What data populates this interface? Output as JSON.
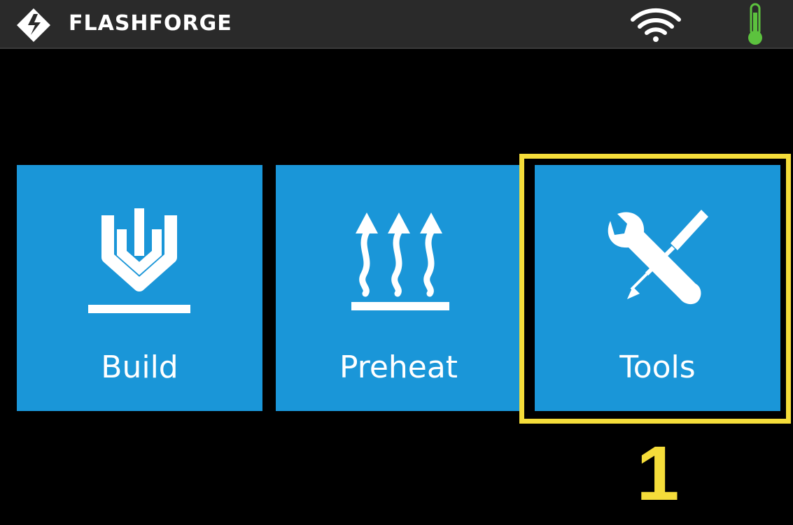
{
  "header": {
    "brand": "FLASHFORGE",
    "logo_icon": "flashforge-logo-icon",
    "wifi_icon": "wifi-icon",
    "temperature_icon": "thermometer-icon"
  },
  "menu": {
    "tiles": [
      {
        "label": "Build",
        "icon": "build-icon"
      },
      {
        "label": "Preheat",
        "icon": "preheat-icon"
      },
      {
        "label": "Tools",
        "icon": "tools-icon"
      }
    ]
  },
  "annotation": {
    "step_number": "1",
    "color": "#f5dd3a"
  },
  "colors": {
    "tile": "#1a96d8",
    "header": "#2a2a2a",
    "background": "#000000",
    "thermometer": "#5cc23e"
  }
}
